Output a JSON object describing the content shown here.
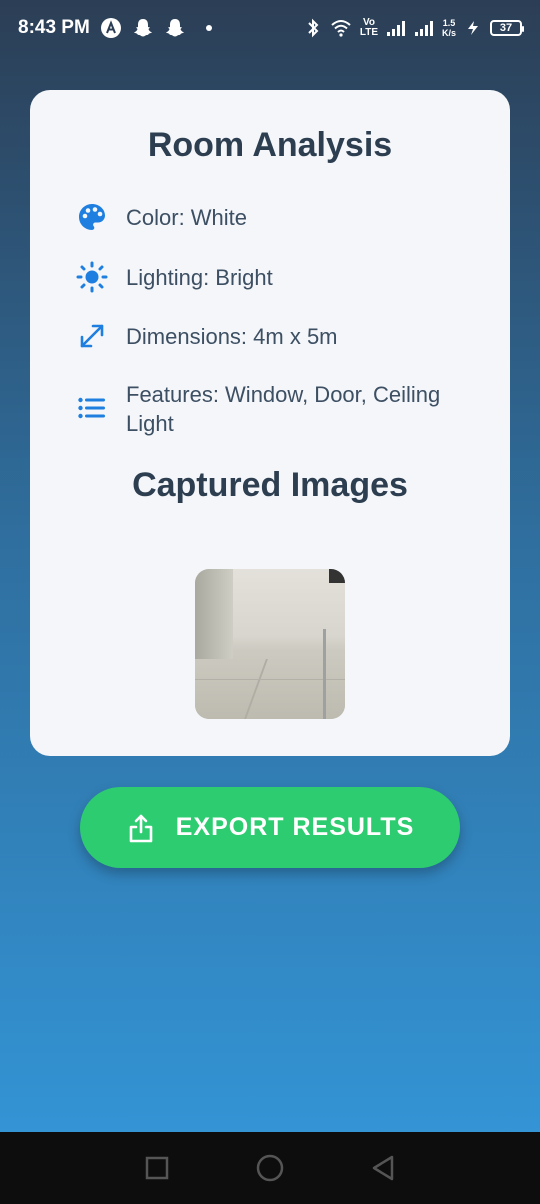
{
  "status_bar": {
    "time": "8:43 PM",
    "network_label": "Vo LTE",
    "speed_value": "1.5",
    "speed_unit": "K/s",
    "battery": "37"
  },
  "analysis": {
    "title": "Room Analysis",
    "items": [
      {
        "icon": "palette-icon",
        "label": "Color: White"
      },
      {
        "icon": "sun-icon",
        "label": "Lighting: Bright"
      },
      {
        "icon": "resize-arrows-icon",
        "label": "Dimensions: 4m x 5m"
      },
      {
        "icon": "list-icon",
        "label": "Features: Window, Door, Ceiling Light"
      }
    ]
  },
  "captured": {
    "title": "Captured Images"
  },
  "actions": {
    "export_label": "EXPORT RESULTS"
  },
  "colors": {
    "accent_blue": "#1e7fe0",
    "button_green": "#2ecc71",
    "title_text": "#2c3e50"
  }
}
